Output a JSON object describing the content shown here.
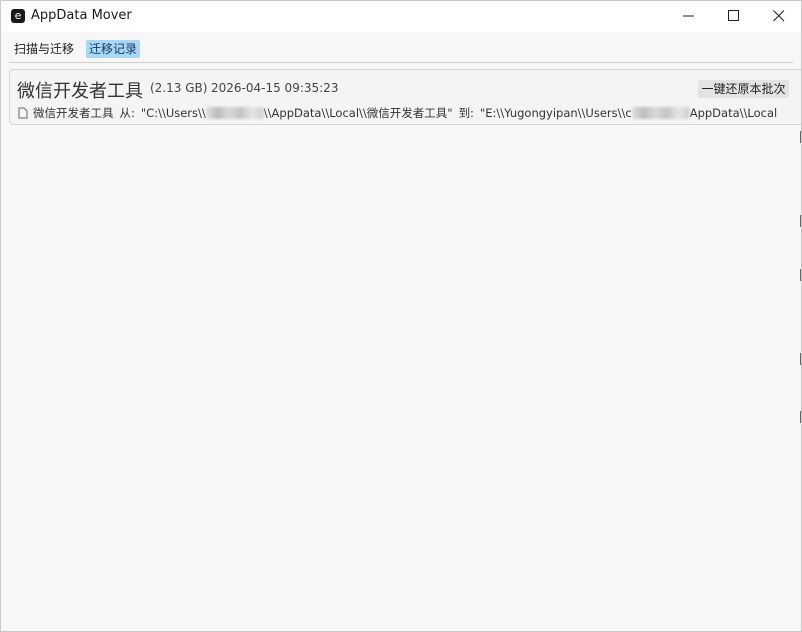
{
  "window": {
    "title": "AppData Mover",
    "app_icon_glyph": "e"
  },
  "titlebar_buttons": {
    "minimize_icon": "minimize-icon",
    "maximize_icon": "maximize-icon",
    "close_icon": "close-icon"
  },
  "tabs": [
    {
      "label": "扫描与迁移",
      "active": false
    },
    {
      "label": "迁移记录",
      "active": true
    }
  ],
  "records": [
    {
      "name": "微信开发者工具",
      "size": "(2.13 GB)",
      "time": "2026-04-15 09:35:23",
      "restore_label": "一键还原本批次",
      "detail": {
        "name": "微信开发者工具",
        "from_label": "从:",
        "from_path_prefix": "\"C:\\\\Users\\\\",
        "from_path_suffix": "\\\\AppData\\\\Local\\\\微信开发者工具\"",
        "to_label": "到:",
        "to_path_prefix": "\"E:\\\\Yugongyipan\\\\Users\\\\c",
        "to_path_suffix": "AppData\\\\Local"
      }
    }
  ],
  "colors": {
    "active_tab_bg": "#a8d8f8",
    "window_bg": "#f7f7f7",
    "card_bg": "#f4f4f4",
    "restore_btn_bg": "#e3e3e3"
  }
}
